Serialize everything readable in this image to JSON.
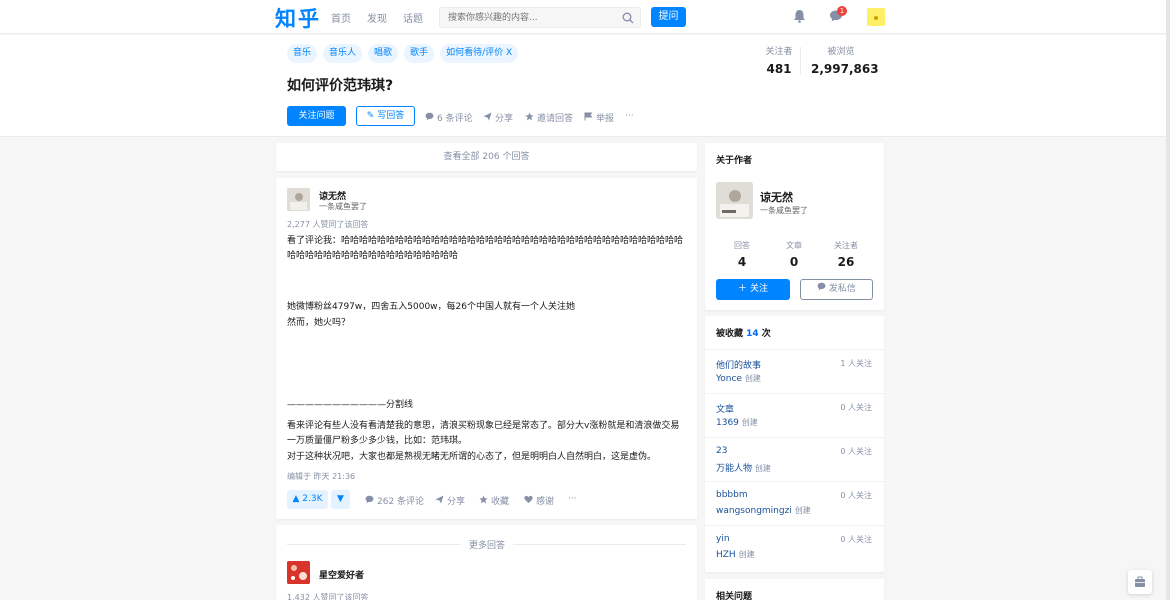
{
  "topbar": {
    "logo": "知乎",
    "nav": [
      "首页",
      "发现",
      "话题"
    ],
    "search_placeholder": "搜索你感兴趣的内容...",
    "ask_label": "提问",
    "notification_count": "1"
  },
  "question": {
    "tags": [
      "音乐",
      "音乐人",
      "唱歌",
      "歌手",
      "如何看待/评价 X"
    ],
    "title": "如何评价范玮琪?",
    "followers_label": "关注者",
    "followers": "481",
    "views_label": "被浏览",
    "views": "2,997,863",
    "follow_label": "关注问题",
    "write_label": "写回答",
    "comments_label": "6 条评论",
    "share_label": "分享",
    "invite_label": "邀请回答",
    "report_label": "举报",
    "more_label": "···"
  },
  "view_all": "查看全部 206 个回答",
  "answer": {
    "author": "谅无然",
    "bio": "一条咸鱼罢了",
    "votes_text": "2,277 人赞同了该回答",
    "lines": {
      "p1": "看了评论我：哈哈哈哈哈哈哈哈哈哈哈哈哈哈哈哈哈哈哈哈哈哈哈哈哈哈哈哈哈哈哈哈哈哈哈哈哈哈哈哈哈哈哈哈哈哈哈哈哈哈哈哈哈哈哈哈哈",
      "p2": "她微博粉丝4797w，四舍五入5000w，每26个中国人就有一个人关注她",
      "p3": "然而，她火吗？",
      "p4": "———————————分割线",
      "p5": "看来评论有些人没有看清楚我的意思，清浪买粉现象已经是常态了。部分大v涨粉就是和清浪做交易一万质量僵尸粉多少多少钱，比如：范玮琪。",
      "p6": "对于这种状况吧，大家也都是熟视无睹无所谓的心态了，但是明明白人自然明白，这是虚伪。"
    },
    "edited": "编辑于 昨天 21:36",
    "upvote": "▲ 2.3K",
    "downvote": "▼",
    "comments": "262 条评论",
    "share": "分享",
    "favorite": "收藏",
    "thanks": "感谢",
    "more": "···"
  },
  "more_answers": {
    "label": "更多回答",
    "author": "星空爱好者",
    "votes_text": "1,432 人赞同了该回答"
  },
  "about_author": {
    "title": "关于作者",
    "name": "谅无然",
    "bio": "一条咸鱼罢了",
    "stats": [
      {
        "label": "回答",
        "value": "4"
      },
      {
        "label": "文章",
        "value": "0"
      },
      {
        "label": "关注者",
        "value": "26"
      }
    ],
    "follow_label": "关注",
    "message_label": "发私信"
  },
  "collected": {
    "title_prefix": "被收藏 ",
    "count": "14",
    "title_suffix": " 次",
    "items": [
      {
        "name": "他们的故事",
        "creator": "Yonce",
        "created": "创建",
        "followers": "1 人关注"
      },
      {
        "name": "文章",
        "creator": "1369",
        "created": "创建",
        "followers": "0 人关注"
      },
      {
        "name": "23",
        "creator": "万能人物",
        "created": "创建",
        "followers": "0 人关注"
      },
      {
        "name": "bbbbm",
        "creator": "wangsongmingzi",
        "created": "创建",
        "followers": "0 人关注"
      },
      {
        "name": "yin",
        "creator": "HZH",
        "created": "创建",
        "followers": "0 人关注"
      }
    ]
  },
  "related": {
    "title": "相关问题"
  },
  "colors": {
    "brand": "#0084ff",
    "link": "#175199",
    "muted": "#8590a6"
  }
}
